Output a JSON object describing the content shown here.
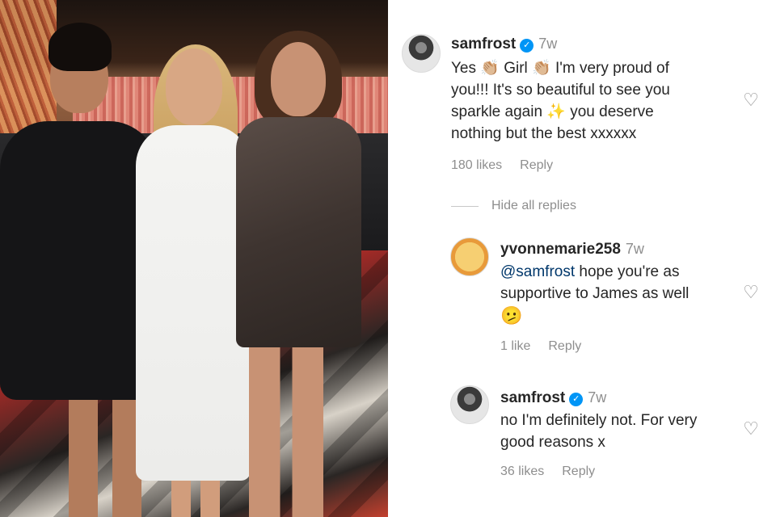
{
  "photo": {
    "alt": ""
  },
  "comments": [
    {
      "username": "samfrost",
      "verified": true,
      "time": "7w",
      "lines": [
        "Yes 👏🏼 Girl 👏🏼 I'm very proud of",
        "you!!! It's so beautiful to see you",
        "sparkle again ✨ you deserve",
        "nothing but the best xxxxxx"
      ],
      "likes": "180 likes",
      "reply": "Reply"
    }
  ],
  "hide_replies_label": "Hide all replies",
  "replies": [
    {
      "username": "yvonnemarie258",
      "verified": false,
      "time": "7w",
      "mention": "@samfrost",
      "line1_rest": " hope you're as",
      "line2": "supportive to James as well",
      "emoji": "🫤",
      "likes": "1 like",
      "reply": "Reply"
    },
    {
      "username": "samfrost",
      "verified": true,
      "time": "7w",
      "line1": "no I'm definitely not. For very",
      "line2": "good reasons x",
      "likes": "36 likes",
      "reply": "Reply"
    }
  ],
  "icons": {
    "verified": "verified-badge-icon",
    "like": "heart-outline-icon"
  },
  "colors": {
    "text": "#262626",
    "muted": "#8e8e8e",
    "link": "#00376b",
    "verified": "#0095f6"
  }
}
